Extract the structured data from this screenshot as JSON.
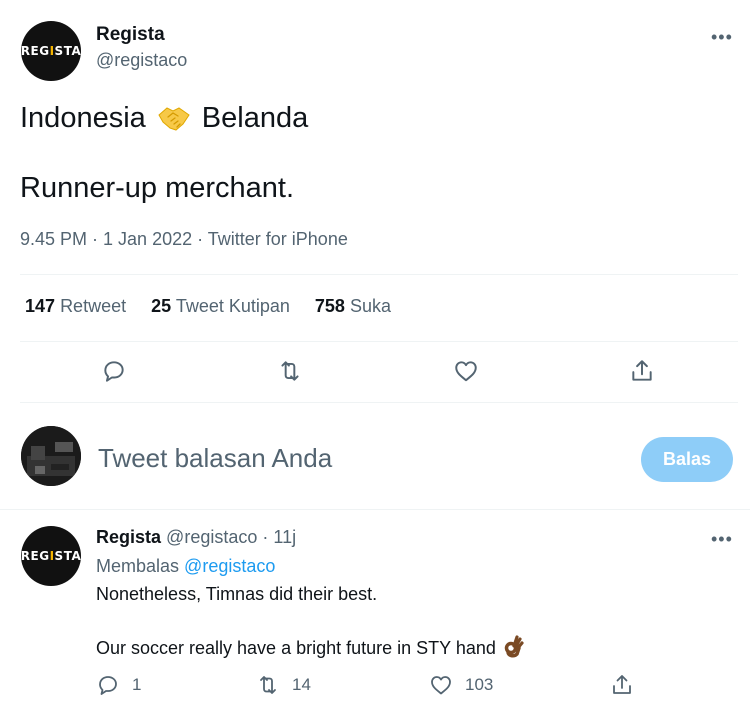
{
  "tweet": {
    "author_name": "Regista",
    "author_handle": "@registaco",
    "avatar_text": "REGISTA",
    "line1_left": "Indonesia",
    "line1_emoji": "handshake-emoji",
    "line1_right": "Belanda",
    "line2": "Runner-up merchant.",
    "meta": "9.45 PM · 1 Jan 2022 · Twitter for iPhone",
    "more": "•••"
  },
  "stats": {
    "retweets_count": "147",
    "retweets_label": "Retweet",
    "quotes_count": "25",
    "quotes_label": "Tweet Kutipan",
    "likes_count": "758",
    "likes_label": "Suka"
  },
  "actions": {
    "icons": [
      "reply-icon",
      "retweet-icon",
      "like-icon",
      "share-icon"
    ]
  },
  "composer": {
    "placeholder": "Tweet balasan Anda",
    "button": "Balas"
  },
  "reply": {
    "author_name": "Regista",
    "author_handle": "@registaco",
    "sep": "·",
    "time": "11j",
    "replying_label": "Membalas",
    "replying_to": "@registaco",
    "text1": "Nonetheless, Timnas did their best.",
    "text2": "Our soccer really have a bright future in STY hand",
    "text2_emoji": "ok-hand-emoji",
    "reply_count": "1",
    "retweet_count": "14",
    "like_count": "103",
    "more": "•••"
  },
  "colors": {
    "text": "#0f1419",
    "secondary": "#536471",
    "link": "#1d9bf0",
    "button_disabled": "#8ecdf8",
    "divider": "#eff3f4"
  }
}
